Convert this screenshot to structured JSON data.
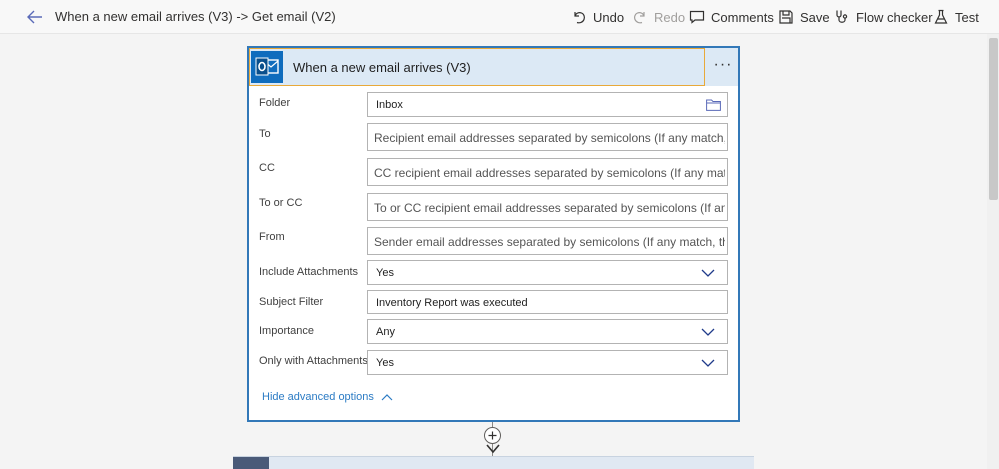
{
  "header": {
    "breadcrumb": "When a new email arrives (V3) -> Get email (V2)",
    "actions": {
      "undo": "Undo",
      "redo": "Redo",
      "comments": "Comments",
      "save": "Save",
      "flow_checker": "Flow checker",
      "test": "Test"
    }
  },
  "card": {
    "title": "When a new email arrives (V3)",
    "more_label": "···",
    "fields": {
      "folder": {
        "label": "Folder",
        "value": "Inbox"
      },
      "to": {
        "label": "To",
        "placeholder": "Recipient email addresses separated by semicolons (If any match, the"
      },
      "cc": {
        "label": "CC",
        "placeholder": "CC recipient email addresses separated by semicolons (If any match,"
      },
      "to_or_cc": {
        "label": "To or CC",
        "placeholder": "To or CC recipient email addresses separated by semicolons (If any m"
      },
      "from": {
        "label": "From",
        "placeholder": "Sender email addresses separated by semicolons (If any match, the t"
      },
      "include_attachments": {
        "label": "Include Attachments",
        "value": "Yes"
      },
      "subject_filter": {
        "label": "Subject Filter",
        "value": "Inventory Report was executed"
      },
      "importance": {
        "label": "Importance",
        "value": "Any"
      },
      "only_with_attachments": {
        "label": "Only with Attachments",
        "value": "Yes"
      }
    },
    "advanced_toggle": "Hide advanced options"
  },
  "colors": {
    "accent": "#3278b8",
    "header_bg": "#dce9f5",
    "focus_outline": "#e8a93a",
    "link": "#2b7bc4",
    "outlook_icon": "#0f6cbd"
  }
}
